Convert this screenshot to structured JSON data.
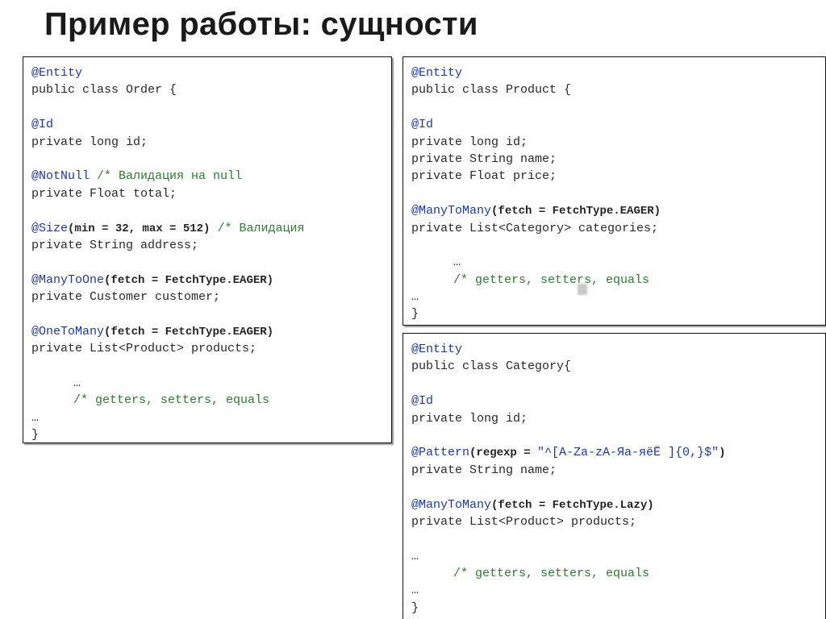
{
  "slide": {
    "title": "Пример работы: сущности"
  },
  "order_block": {
    "entity_annotation": "@Entity",
    "class_decl": "public class Order {",
    "id_annotation": "@Id",
    "id_field": "private long id;",
    "notnull_annotation": "@NotNull",
    "notnull_comment": "/* Валидация на null",
    "total_field": "private Float total;",
    "size_annotation": "@Size",
    "size_args": "(min = 32, max = 512)",
    "size_comment": "/* Валидация",
    "address_field": "private String address;",
    "manytoone_annotation": "@ManyToOne",
    "manytoone_args": "(fetch = FetchType.EAGER)",
    "customer_field": "private Customer customer;",
    "onetomany_annotation": "@OneToMany",
    "onetomany_args": "(fetch = FetchType.EAGER)",
    "products_field": "private List<Product> products;",
    "ellipsis_inner": "…",
    "getters_comment": "/* getters, setters, equals",
    "ellipsis_outer": "…",
    "closing_brace": "}"
  },
  "product_block": {
    "entity_annotation": "@Entity",
    "class_decl": "public class Product {",
    "id_annotation": "@Id",
    "id_field": "private long id;",
    "name_field": "private String name;",
    "price_field": "private Float price;",
    "manytomany_annotation": "@ManyToMany",
    "manytomany_args": "(fetch = FetchType.EAGER)",
    "categories_field": "private List<Category> categories;",
    "ellipsis_inner": "…",
    "getters_comment": "/* getters, setters, equals",
    "ellipsis_outer": "…",
    "closing_brace": "}"
  },
  "category_block": {
    "entity_annotation": "@Entity",
    "class_decl": "public class Category{",
    "id_annotation": "@Id",
    "id_field": "private long id;",
    "pattern_annotation": "@Pattern",
    "pattern_args_start": "(regexp = ",
    "pattern_regex": "\"^[A-Za-zA-Яа-яёЁ ]{0,}$\"",
    "pattern_args_end": ")",
    "name_field": "private String name;",
    "manytomany_annotation": "@ManyToMany",
    "manytomany_args": "(fetch = FetchType.Lazy)",
    "products_field": "private List<Product> products;",
    "ellipsis_inner": "…",
    "getters_comment": "/* getters, setters, equals",
    "ellipsis_outer": "…",
    "closing_brace": "}"
  },
  "colors": {
    "annotation": "#1e3a9e",
    "comment": "#2e7d32",
    "text": "#2a2a2a"
  }
}
